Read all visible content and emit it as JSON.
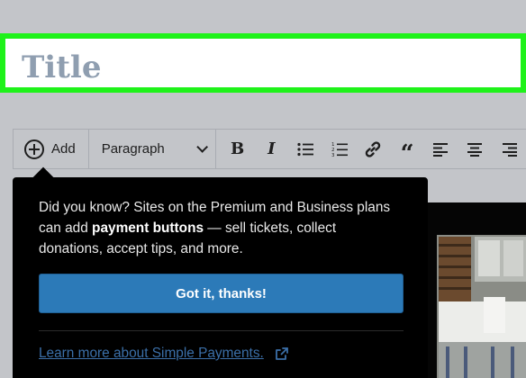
{
  "title": {
    "placeholder": "Title"
  },
  "toolbar": {
    "add_label": "Add",
    "block_type": "Paragraph",
    "buttons": [
      {
        "name": "bold",
        "glyph": "B"
      },
      {
        "name": "italic",
        "glyph": "I"
      },
      {
        "name": "bulleted-list",
        "glyph": ""
      },
      {
        "name": "numbered-list",
        "glyph": ""
      },
      {
        "name": "link",
        "glyph": ""
      },
      {
        "name": "quote",
        "glyph": "“"
      },
      {
        "name": "align-left",
        "glyph": ""
      },
      {
        "name": "align-center",
        "glyph": ""
      },
      {
        "name": "align-right",
        "glyph": ""
      }
    ]
  },
  "popover": {
    "text_before": "Did you know? Sites on the Premium and Business plans can add ",
    "text_bold": "payment buttons",
    "text_after": " — sell tickets, collect donations, accept tips, and more.",
    "button_label": "Got it, thanks!",
    "link_label": "Learn more about Simple Payments."
  },
  "colors": {
    "highlight": "#1ff21a",
    "button": "#2c7ab8",
    "link": "#3b6fa8",
    "background": "#c3c5c9"
  }
}
